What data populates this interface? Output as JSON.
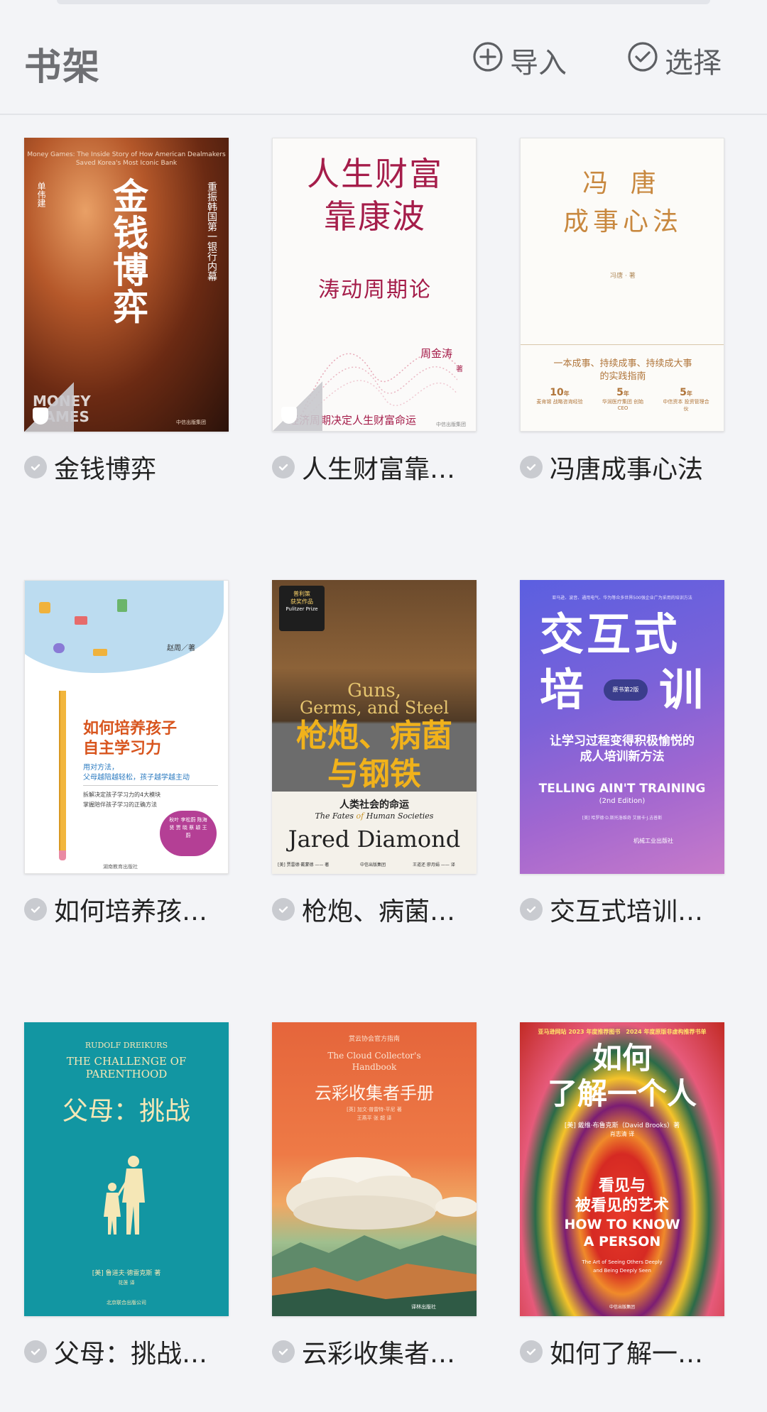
{
  "header": {
    "title": "书架",
    "import_label": "导入",
    "select_label": "选择"
  },
  "books": [
    {
      "label": "金钱博弈",
      "cover": {
        "title": "金钱博弈",
        "top_en": "Money Games: The Inside Story of How American Dealmakers Saved Korea's Most Iconic Bank",
        "side_right": "重振韩国第一银行内幕",
        "side_left": "单伟建",
        "brand": "MONEY GAMES",
        "publisher": "中信出版集团"
      }
    },
    {
      "label": "人生财富靠…",
      "cover": {
        "title_line1": "人生财富",
        "title_line2": "靠康波",
        "subtitle": "涛动周期论",
        "author": "周金涛",
        "author_suffix": "著",
        "tagline": "经济周期决定人生财富命运",
        "publisher": "中信出版集团"
      }
    },
    {
      "label": "冯唐成事心法",
      "cover": {
        "title_line1": "冯 唐",
        "title_line2": "成事心法",
        "author": "冯唐 · 著",
        "tagline1": "一本成事、持续成事、持续成大事",
        "tagline2": "的实践指南",
        "stats": [
          {
            "num": "10",
            "unit": "年",
            "desc": "麦肯锡 战略咨询经验"
          },
          {
            "num": "5",
            "unit": "年",
            "desc": "华润医疗集团 创始CEO"
          },
          {
            "num": "5",
            "unit": "年",
            "desc": "中信资本 投资管理合伙"
          }
        ]
      }
    },
    {
      "label": "如何培养孩…",
      "cover": {
        "author": "赵周／著",
        "title_line1": "如何培养孩子",
        "title_line2": "自主学习力",
        "sub1": "用对方法，",
        "sub2": "父母越陪越轻松，孩子越学越主动",
        "desc1": "拆解决定孩子学习力的4大模块",
        "desc2": "掌握陪伴孩子学习的正确方法",
        "badge": "秋叶 李松蔚 陈海贤 贾 晓 蔡 颖 王 蔚",
        "publisher": "湖南教育出版社"
      }
    },
    {
      "label": "枪炮、病菌…",
      "cover": {
        "en_title1": "Guns,",
        "en_title2": "Germs, and Steel",
        "title_line1": "枪炮、病菌",
        "title_line2": "与钢铁",
        "sub_cn": "人类社会的命运",
        "sub_en_a": "The Fates ",
        "sub_en_of": "of",
        "sub_en_b": " Human Societies",
        "author_en": "Jared Diamond",
        "badge1": "普利策",
        "badge2": "获奖作品",
        "badge3": "Pulitzer Prize",
        "credits": "[美] 贾雷德·戴蒙德 —— 著",
        "publisher": "中信出版集团",
        "translators": "王道还 廖月娟 —— 译"
      }
    },
    {
      "label": "交互式培训…",
      "cover": {
        "top": "亚马逊、波音、通用电气、华为等众多世界500强企业广为采用的培训方法",
        "title_line1": "交互式",
        "title_line2_a": "培",
        "title_line2_b": "训",
        "edition": "原书第2版",
        "sub1": "让学习过程变得积极愉悦的",
        "sub2": "成人培训新方法",
        "en_title": "TELLING AIN'T TRAINING",
        "en_edition": "(2nd Edition)",
        "authors": "[美] 哈罗德·D.斯托洛维奇 艾丽卡·J.吉普斯",
        "publisher": "机械工业出版社"
      }
    },
    {
      "label": "父母：挑战…",
      "cover": {
        "author_en": "RUDOLF DREIKURS",
        "en_title1": "THE CHALLENGE OF",
        "en_title2": "PARENTHOOD",
        "title": "父母：挑战",
        "author_cn": "[美] 鲁道夫·德雷克斯 著",
        "translator": "花莲 译",
        "publisher": "北京联合出版公司"
      }
    },
    {
      "label": "云彩收集者…",
      "cover": {
        "top": "赏云协会官方指南",
        "en_title1": "The Cloud Collector's",
        "en_title2": "Handbook",
        "title": "云彩收集者手册",
        "credits": "[英] 加文·普雷特-平尼 著",
        "translators": "王燕平 张 超 译",
        "publisher": "译林出版社"
      }
    },
    {
      "label": "如何了解一…",
      "cover": {
        "top1": "亚马逊网站 2023 年度推荐图书",
        "top2": "2024 年度原版非虚构推荐书单",
        "title_line1": "如何",
        "title_line2": "了解一个人",
        "author": "[美] 戴维·布鲁克斯（David Brooks）著",
        "translator": "肖志清 译",
        "sub1": "看见与",
        "sub2": "被看见的艺术",
        "en_title1": "HOW TO KNOW",
        "en_title2": "A PERSON",
        "en_sub1": "The Art of Seeing Others Deeply",
        "en_sub2": "and Being Deeply Seen",
        "publisher": "中信出版集团"
      }
    }
  ]
}
